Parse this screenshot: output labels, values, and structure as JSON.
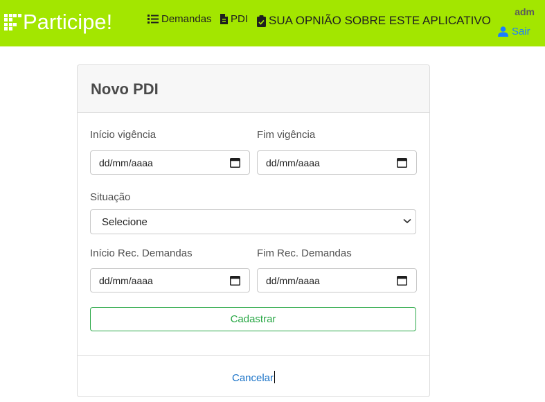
{
  "navbar": {
    "brand": "Participe!",
    "items": [
      {
        "label": "Demandas",
        "icon": "list-icon"
      },
      {
        "label": "PDI",
        "icon": "file-icon"
      },
      {
        "label": "SUA OPNIÃO SOBRE ESTE APLICATIVO",
        "icon": "clipboard-check-icon"
      }
    ],
    "user": "adm",
    "logout": "Sair",
    "colors": {
      "background": "#a3e600",
      "link": "#1a7dff"
    }
  },
  "form": {
    "title": "Novo PDI",
    "inicio_vigencia": {
      "label": "Início vigência",
      "placeholder": "dd/mm/aaaa"
    },
    "fim_vigencia": {
      "label": "Fim vigência",
      "placeholder": "dd/mm/aaaa"
    },
    "situacao": {
      "label": "Situação",
      "selected": "Selecione"
    },
    "inicio_rec": {
      "label": "Início Rec. Demandas",
      "placeholder": "dd/mm/aaaa"
    },
    "fim_rec": {
      "label": "Fim Rec. Demandas",
      "placeholder": "dd/mm/aaaa"
    },
    "submit_label": "Cadastrar",
    "cancel_label": "Cancelar",
    "colors": {
      "submit": "#28a745"
    }
  }
}
